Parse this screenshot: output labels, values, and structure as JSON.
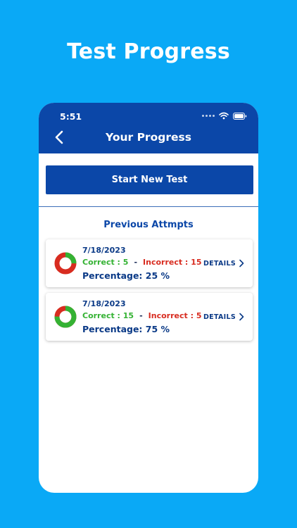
{
  "promo": {
    "title": "Test Progress"
  },
  "status_bar": {
    "time": "5:51"
  },
  "header": {
    "title": "Your Progress"
  },
  "start_button": {
    "label": "Start New Test"
  },
  "section": {
    "title": "Previous Attmpts"
  },
  "attempts": [
    {
      "date": "7/18/2023",
      "correct_text": "Correct : 5",
      "separator": "-",
      "incorrect_text": "Incorrect : 15",
      "percentage_text": "Percentage: 25 %",
      "details_label": "DETAILS",
      "correct_fraction": 0.25
    },
    {
      "date": "7/18/2023",
      "correct_text": "Correct : 15",
      "separator": "-",
      "incorrect_text": "Incorrect : 5",
      "percentage_text": "Percentage: 75 %",
      "details_label": "DETAILS",
      "correct_fraction": 0.75
    }
  ],
  "colors": {
    "background": "#0aa9f6",
    "primary": "#0b47a8",
    "correct": "#34b233",
    "incorrect": "#d82c20"
  },
  "icons": {
    "back": "chevron-left-icon",
    "details": "chevron-right-icon",
    "wifi": "wifi-icon",
    "battery": "battery-icon"
  }
}
